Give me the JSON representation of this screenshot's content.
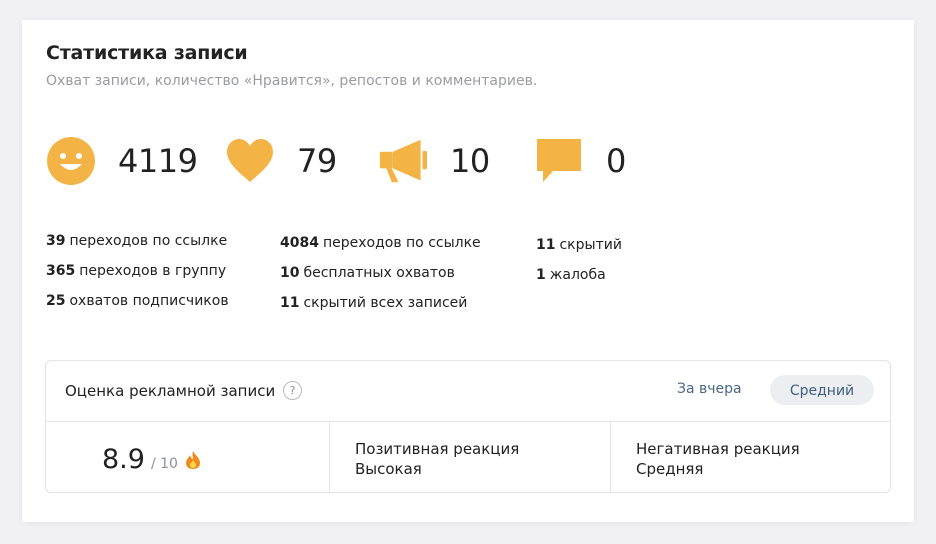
{
  "card": {
    "title": "Статистика записи",
    "subtitle": "Охват записи, количество «Нравится», репостов и комментариев."
  },
  "stats": {
    "reach": {
      "icon": "smile-icon",
      "value": "4119"
    },
    "likes": {
      "icon": "heart-icon",
      "value": "79"
    },
    "reposts": {
      "icon": "megaphone-icon",
      "value": "10"
    },
    "comments": {
      "icon": "comment-icon",
      "value": "0"
    }
  },
  "details": {
    "col1": [
      {
        "num": "39",
        "text": "переходов по ссылке"
      },
      {
        "num": "365",
        "text": "переходов в группу"
      },
      {
        "num": "25",
        "text": "охватов подписчиков"
      }
    ],
    "col2": [
      {
        "num": "4084",
        "text": "переходов по ссылке"
      },
      {
        "num": "10",
        "text": "бесплатных охватов"
      },
      {
        "num": "11",
        "text": "скрытий всех записей"
      }
    ],
    "col3": [
      {
        "num": "11",
        "text": "скрытий"
      },
      {
        "num": "1",
        "text": "жалоба"
      }
    ]
  },
  "ad_rating": {
    "title": "Оценка рекламной записи",
    "help": "?",
    "period": "За вчера",
    "level_button": "Средний",
    "score": "8.9",
    "score_max": "/ 10",
    "positive_label": "Позитивная реакция",
    "positive_value": "Высокая",
    "negative_label": "Негативная реакция",
    "negative_value": "Средняя"
  },
  "colors": {
    "accent": "#f3b445",
    "link": "#4a6785"
  }
}
